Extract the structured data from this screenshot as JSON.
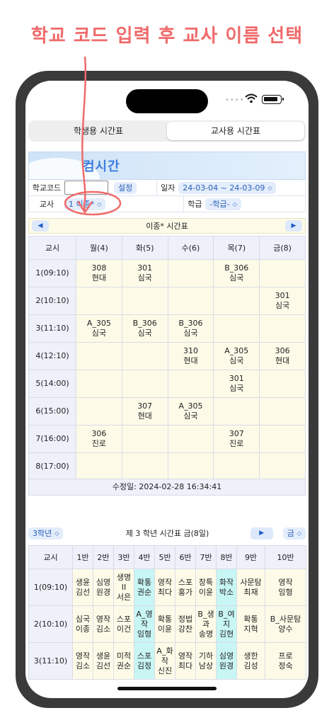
{
  "annotation": {
    "text": "학교 코드 입력 후 교사 이름 선택",
    "color": "#f06a6a"
  },
  "tabs": [
    {
      "label": "학생용 시간표",
      "active": false
    },
    {
      "label": "교사용 시간표",
      "active": true
    }
  ],
  "banner": {
    "logo": "컴시간"
  },
  "form": {
    "school_code_label": "학교코드",
    "school_code_value": "",
    "set_button": "설정",
    "date_label": "일자",
    "date_value": "24-03-04 ~ 24-03-09",
    "teacher_label": "교사",
    "teacher_value": "1 이종*",
    "term_label": "학급",
    "term_value": "-학급-"
  },
  "teacher_table": {
    "title": "이종* 시간표",
    "headers": [
      "교시",
      "월(4)",
      "화(5)",
      "수(6)",
      "목(7)",
      "금(8)"
    ],
    "rows": [
      {
        "period": "1(09:10)",
        "cells": [
          [
            "308",
            "현대"
          ],
          [
            "301",
            "심국"
          ],
          [
            "",
            ""
          ],
          [
            "B_306",
            "심국"
          ],
          [
            "",
            ""
          ]
        ]
      },
      {
        "period": "2(10:10)",
        "cells": [
          [
            "",
            ""
          ],
          [
            "",
            ""
          ],
          [
            "",
            ""
          ],
          [
            "",
            ""
          ],
          [
            "301",
            "심국"
          ]
        ]
      },
      {
        "period": "3(11:10)",
        "cells": [
          [
            "A_305",
            "심국"
          ],
          [
            "B_306",
            "심국"
          ],
          [
            "B_306",
            "심국"
          ],
          [
            "",
            ""
          ],
          [
            "",
            ""
          ]
        ]
      },
      {
        "period": "4(12:10)",
        "cells": [
          [
            "",
            ""
          ],
          [
            "",
            ""
          ],
          [
            "310",
            "현대"
          ],
          [
            "A_305",
            "심국"
          ],
          [
            "306",
            "현대"
          ]
        ]
      },
      {
        "period": "5(14:00)",
        "cells": [
          [
            "",
            ""
          ],
          [
            "",
            ""
          ],
          [
            "",
            ""
          ],
          [
            "301",
            "심국"
          ],
          [
            "",
            ""
          ]
        ]
      },
      {
        "period": "6(15:00)",
        "cells": [
          [
            "",
            ""
          ],
          [
            "307",
            "현대"
          ],
          [
            "A_305",
            "심국"
          ],
          [
            "",
            ""
          ],
          [
            "",
            ""
          ]
        ]
      },
      {
        "period": "7(16:00)",
        "cells": [
          [
            "306",
            "진로"
          ],
          [
            "",
            ""
          ],
          [
            "",
            ""
          ],
          [
            "307",
            "진로"
          ],
          [
            "",
            ""
          ]
        ]
      },
      {
        "period": "8(17:00)",
        "cells": [
          [
            "",
            ""
          ],
          [
            "",
            ""
          ],
          [
            "",
            ""
          ],
          [
            "",
            ""
          ],
          [
            "",
            ""
          ]
        ]
      }
    ]
  },
  "modified": "수정일: 2024-02-28 16:34:41",
  "grade_bar": {
    "grade_select": "3학년",
    "title": "제 3 학년 시간표 금(8일)",
    "day_select": "금"
  },
  "class_table": {
    "headers": [
      "교시",
      "1반",
      "2반",
      "3반",
      "4반",
      "5반",
      "6반",
      "7반",
      "8반",
      "9반",
      "10반"
    ],
    "rows": [
      {
        "period": "1(09:10)",
        "cells": [
          {
            "t": [
              "생윤",
              "김선"
            ]
          },
          {
            "t": [
              "심영",
              "원경"
            ]
          },
          {
            "t": [
              "생명",
              "II",
              "서은"
            ]
          },
          {
            "t": [
              "확통",
              "권순"
            ],
            "hl": true
          },
          {
            "t": [
              "영작",
              "최다"
            ]
          },
          {
            "t": [
              "스포",
              "홍가"
            ]
          },
          {
            "t": [
              "창특",
              "이윤"
            ]
          },
          {
            "t": [
              "화작",
              "박소"
            ],
            "hl": true
          },
          {
            "t": [
              "사문탐",
              "최재"
            ]
          },
          {
            "t": [
              "영작",
              "임형"
            ]
          }
        ]
      },
      {
        "period": "2(10:10)",
        "cells": [
          {
            "t": [
              "심국",
              "이종"
            ]
          },
          {
            "t": [
              "영작",
              "김소"
            ]
          },
          {
            "t": [
              "스포",
              "이건"
            ]
          },
          {
            "t": [
              "A_영",
              "작",
              "임형"
            ],
            "hl": true
          },
          {
            "t": [
              "확통",
              "이윤"
            ]
          },
          {
            "t": [
              "정법",
              "강찬"
            ]
          },
          {
            "t": [
              "B_생",
              "과",
              "송명"
            ]
          },
          {
            "t": [
              "B_여",
              "지",
              "김현"
            ],
            "hl": true
          },
          {
            "t": [
              "확통",
              "지혁"
            ]
          },
          {
            "t": [
              "B_사문탐",
              "양수"
            ]
          }
        ]
      },
      {
        "period": "3(11:10)",
        "cells": [
          {
            "t": [
              "영작",
              "김소"
            ]
          },
          {
            "t": [
              "생윤",
              "김선"
            ]
          },
          {
            "t": [
              "미적",
              "권순"
            ]
          },
          {
            "t": [
              "스포",
              "김정"
            ],
            "hl": true
          },
          {
            "t": [
              "A_화",
              "작",
              "신진"
            ]
          },
          {
            "t": [
              "영작",
              "최다"
            ]
          },
          {
            "t": [
              "기하",
              "남상"
            ]
          },
          {
            "t": [
              "심영",
              "원경"
            ],
            "hl": true
          },
          {
            "t": [
              "생한",
              "김성"
            ]
          },
          {
            "t": [
              "프로",
              "정숙"
            ]
          }
        ]
      }
    ]
  },
  "nav": {
    "prev": "◀",
    "next": "▶",
    "play": "▶"
  }
}
